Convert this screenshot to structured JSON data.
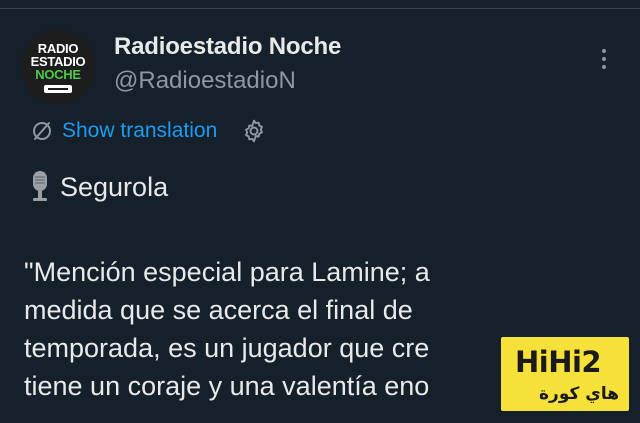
{
  "tweet": {
    "avatar": {
      "line1": "RADIO",
      "line2": "ESTADIO",
      "line3": "NOCHE"
    },
    "display_name": "Radioestadio Noche",
    "handle": "@RadioestadioN",
    "show_translation_label": "Show translation",
    "title": "Segurola",
    "body_lines": [
      "\"Mención especial para Lamine; a",
      "medida que se acerca el final de",
      "temporada, es un jugador que cre",
      "tiene un coraje y una valentía eno"
    ]
  },
  "watermark": {
    "logo_text": "HiHi2",
    "sub_text": "هاي كورة"
  },
  "icons": {
    "more": "more-vertical-icon",
    "translate": "translate-icon",
    "settings": "gear-icon",
    "microphone": "microphone-icon"
  },
  "colors": {
    "background": "#15202b",
    "link": "#1d9bf0",
    "secondary_text": "#8b98a5",
    "watermark_bg": "#f5e13a"
  }
}
